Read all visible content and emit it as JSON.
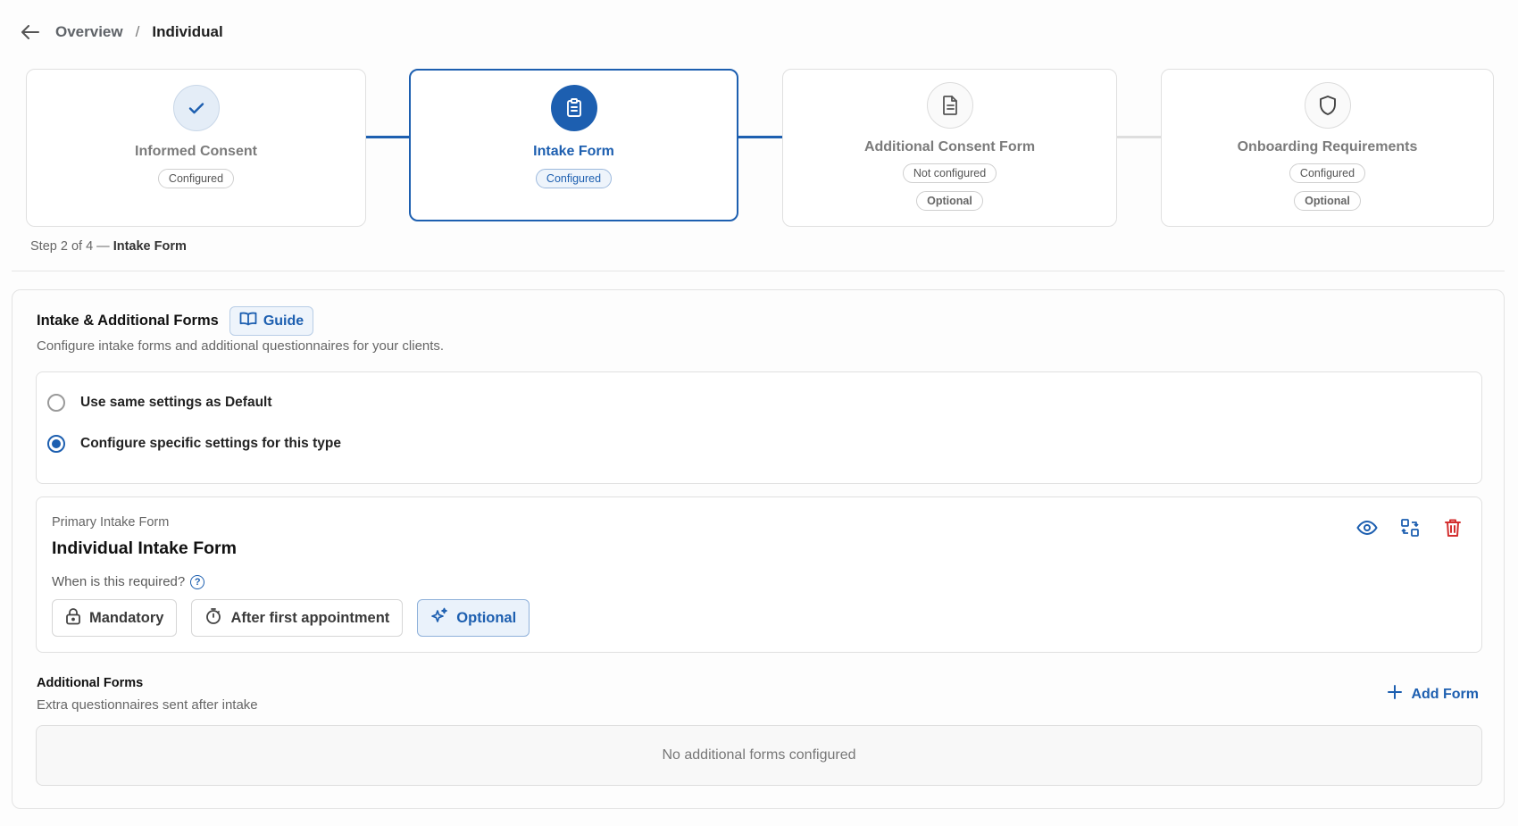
{
  "breadcrumb": {
    "parent": "Overview",
    "separator": "/",
    "current": "Individual"
  },
  "steps": [
    {
      "title": "Informed Consent",
      "badges": [
        "Configured"
      ],
      "icon": "check-icon",
      "state": "done"
    },
    {
      "title": "Intake Form",
      "badges": [
        "Configured"
      ],
      "icon": "clipboard-icon",
      "state": "active"
    },
    {
      "title": "Additional Consent Form",
      "badges": [
        "Not configured",
        "Optional"
      ],
      "icon": "document-icon",
      "state": "pending"
    },
    {
      "title": "Onboarding Requirements",
      "badges": [
        "Configured",
        "Optional"
      ],
      "icon": "shield-icon",
      "state": "pending"
    }
  ],
  "step_caption": {
    "prefix": "Step 2 of 4 —",
    "name": "Intake Form"
  },
  "section": {
    "title": "Intake & Additional Forms",
    "guide_label": "Guide",
    "subtitle": "Configure intake forms and additional questionnaires for your clients.",
    "radio_options": [
      {
        "label": "Use same settings as Default",
        "selected": false
      },
      {
        "label": "Configure specific settings for this type",
        "selected": true
      }
    ]
  },
  "primary_form": {
    "label": "Primary Intake Form",
    "name": "Individual Intake Form",
    "requirement_question": "When is this required?",
    "requirement_options": [
      "Mandatory",
      "After first appointment",
      "Optional"
    ],
    "selected_option": "Optional"
  },
  "additional_forms": {
    "title": "Additional Forms",
    "subtitle": "Extra questionnaires sent after intake",
    "add_label": "Add Form",
    "empty_text": "No additional forms configured"
  },
  "colors": {
    "accent": "#1d5fb0",
    "danger": "#d32f2f",
    "border": "#e0e0e0"
  }
}
